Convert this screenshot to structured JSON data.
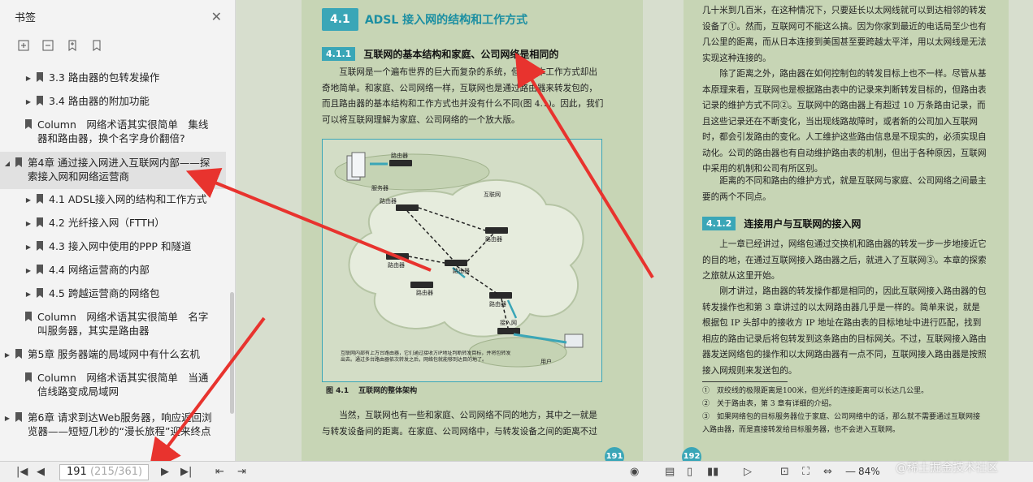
{
  "sidebar": {
    "title": "书签",
    "items": [
      {
        "label": "3.3 路由器的包转发操作"
      },
      {
        "label": "3.4 路由器的附加功能"
      },
      {
        "label": "Column　网络术语其实很简单　集线器和路由器，换个名字身价翻倍?"
      },
      {
        "label": "第4章 通过接入网进入互联网内部——探索接入网和网络运营商"
      },
      {
        "label": "4.1 ADSL接入网的结构和工作方式"
      },
      {
        "label": "4.2 光纤接入网（FTTH）"
      },
      {
        "label": "4.3 接入网中使用的PPP 和隧道"
      },
      {
        "label": "4.4 网络运营商的内部"
      },
      {
        "label": "4.5 跨越运营商的网络包"
      },
      {
        "label": "Column　网络术语其实很简单　名字叫服务器，其实是路由器"
      },
      {
        "label": "第5章 服务器端的局域网中有什么玄机"
      },
      {
        "label": "Column　网络术语其实很简单　当通信线路变成局域网"
      },
      {
        "label": "第6章 请求到达Web服务器，响应返回浏览器——短短几秒的“漫长旅程”迎来终点"
      }
    ]
  },
  "left_page": {
    "section_badge": "4.1",
    "section_title": "ADSL 接入网的结构和工作方式",
    "sub_badge": "4.1.1",
    "sub_title": "互联网的基本结构和家庭、公司网络是相同的",
    "para1": "互联网是一个遍布世界的巨大而复杂的系统，但其基本工作方式却出奇地简单。和家庭、公司网络一样，互联网也是通过路由器来转发包的，而且路由器的基本结构和工作方式也并没有什么不同(图 4.1)。因此，我们可以将互联网理解为家庭、公司网络的一个放大版。",
    "figure": {
      "server_label": "服务器",
      "router_label": "路由器",
      "internet_label": "互联网",
      "access_label": "接入网",
      "user_label": "用户",
      "note": "互联网内部有上万台路由器，它们通过接收方IP地址判断转发目标，并将包转发出去。通过多台路由器依次转发之后，网络包就能够到达目的地了。",
      "caption_no": "图 4.1",
      "caption": "互联网的整体架构"
    },
    "para2": "当然，互联网也有一些和家庭、公司网络不同的地方，其中之一就是与转发设备间的距离。在家庭、公司网络中，与转发设备之间的距离不过",
    "page_no": "191"
  },
  "right_page": {
    "para1": "几十米到几百米，在这种情况下，只要延长以太网线就可以到达相邻的转发设备了①。然而，互联网可不能这么搞。因为你家到最近的电话局至少也有几公里的距离，而从日本连接到美国甚至要跨越太平洋，用以太网线是无法实现这种连接的。",
    "para2": "除了距离之外，路由器在如何控制包的转发目标上也不一样。尽管从基本原理来看，互联网也是根据路由表中的记录来判断转发目标的，但路由表记录的维护方式不同②。互联网中的路由器上有超过 10 万条路由记录，而且这些记录还在不断变化，当出现线路故障时，或者新的公司加入互联网时，都会引发路由的变化。人工维护这些路由信息是不现实的，必须实现自动化。公司的路由器也有自动维护路由表的机制，但出于各种原因，互联网中采用的机制和公司有所区别。",
    "para3": "距离的不同和路由的维护方式，就是互联网与家庭、公司网络之间最主要的两个不同点。",
    "sub_badge": "4.1.2",
    "sub_title": "连接用户与互联网的接入网",
    "para4": "上一章已经讲过，网络包通过交换机和路由器的转发一步一步地接近它的目的地，在通过互联网接入路由器之后，就进入了互联网③。本章的探索之旅就从这里开始。",
    "para5": "刚才讲过，路由器的转发操作都是相同的，因此互联网接入路由器的包转发操作也和第 3 章讲过的以太网路由器几乎是一样的。简单来说，就是根据包 IP 头部中的接收方 IP 地址在路由表的目标地址中进行匹配，找到相应的路由记录后将包转发到这条路由的目标网关。不过，互联网接入路由器发送网络包的操作和以太网路由器有一点不同，互联网接入路由器是按照接入网规则来发送包的。",
    "fn1": "①　双绞线的极限距离是100米，但光纤的连接距离可以长达几公里。",
    "fn2": "②　关于路由表，第 3 章有详细的介绍。",
    "fn3": "③　如果网络包的目标服务器位于家庭、公司网络中的话，那么就不需要通过互联网接入路由器，而是直接转发给目标服务器，也不会进入互联网。",
    "page_no": "192"
  },
  "bottom": {
    "page_current": "191",
    "page_info": "(215/361)",
    "zoom": "84%"
  },
  "watermark": "@稀土掘金技术社区",
  "colors": {
    "accent": "#3aa6b7",
    "arrow": "#e8332e",
    "page_bg": "#c7d5b5"
  }
}
